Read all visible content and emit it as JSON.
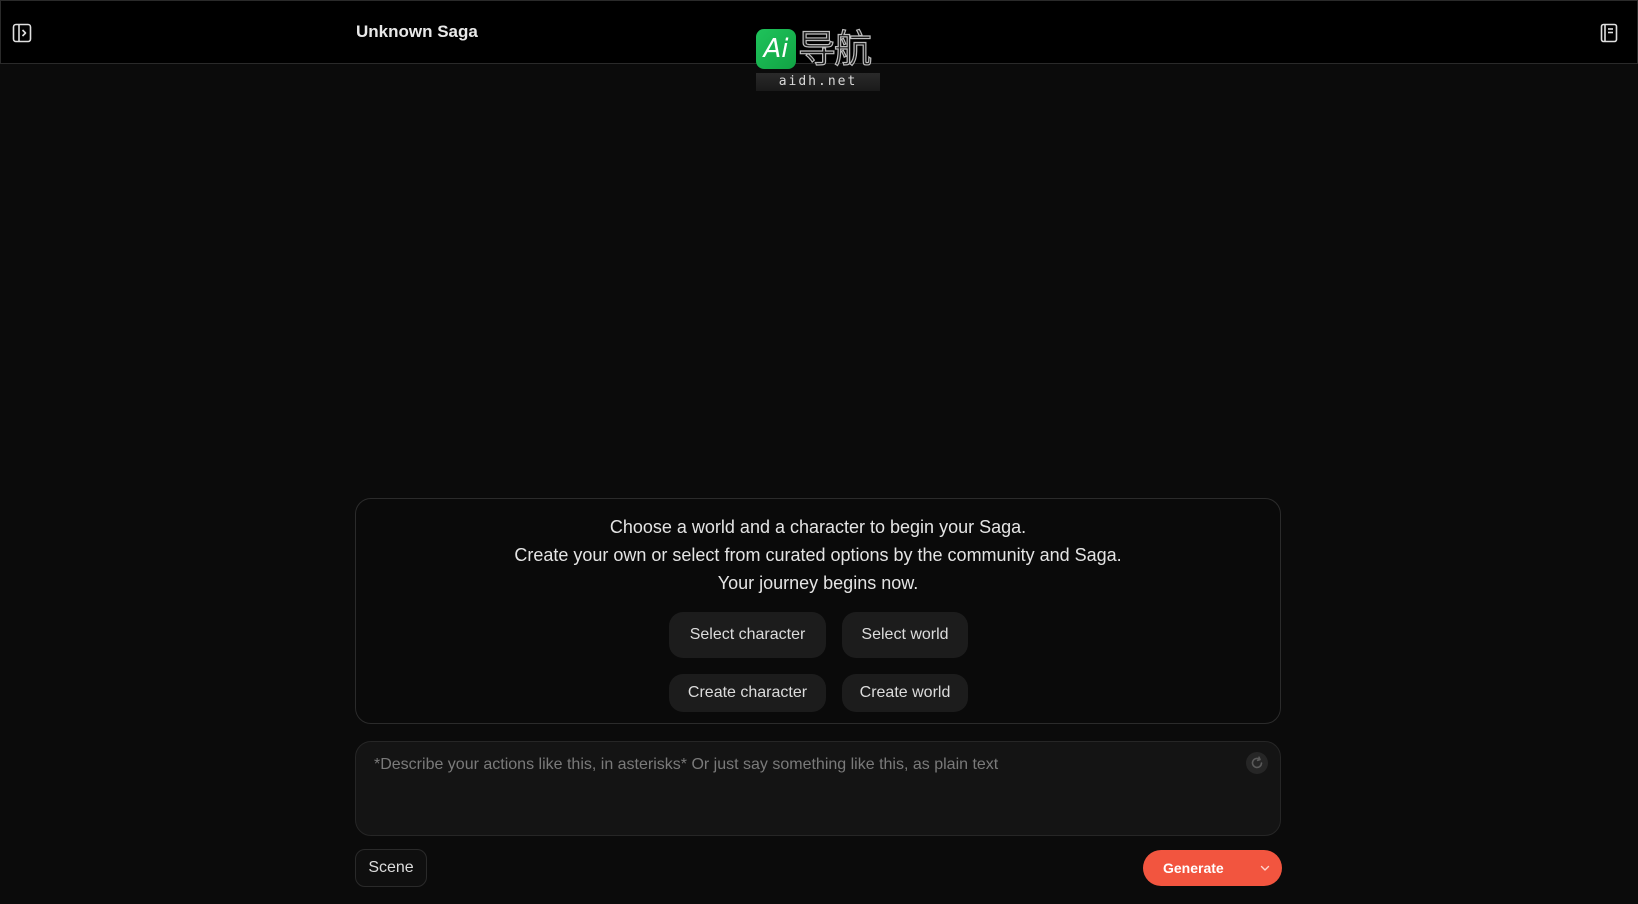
{
  "header": {
    "title": "Unknown Saga",
    "left_icon": "sidebar-toggle-icon",
    "right_icon": "notebook-icon"
  },
  "watermark": {
    "badge": "Ai",
    "cn_text": "导航",
    "url": "aidh.net"
  },
  "intro": {
    "line1": "Choose a world and a character to begin your Saga.",
    "line2": "Create your own or select from curated options by the community and Saga.",
    "line3": "Your journey begins now.",
    "select_character": "Select character",
    "select_world": "Select world",
    "create_character": "Create character",
    "create_world": "Create world"
  },
  "composer": {
    "placeholder": "*Describe your actions like this, in asterisks* Or just say something like this, as plain text",
    "value": "",
    "refresh_icon": "refresh-icon"
  },
  "footer": {
    "scene_label": "Scene",
    "generate_label": "Generate",
    "generate_color": "#f2553f"
  }
}
